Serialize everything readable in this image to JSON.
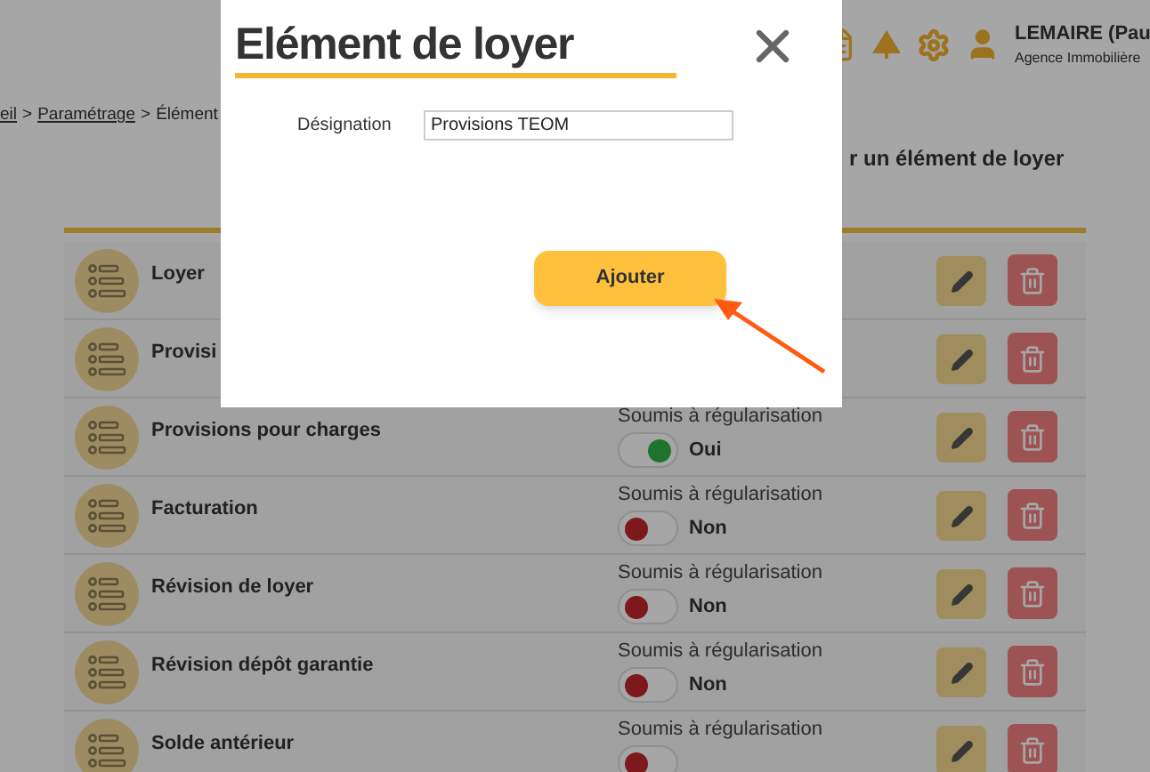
{
  "header": {
    "user_name": "LEMAIRE (Pau",
    "agency": "Agence Immobilière"
  },
  "breadcrumb": [
    {
      "label": "eil",
      "link": true
    },
    {
      "label": ">",
      "link": false
    },
    {
      "label": "Paramétrage",
      "link": true
    },
    {
      "label": ">",
      "link": false
    },
    {
      "label": "Élément",
      "link": false
    }
  ],
  "page_action": "r un élément de loyer",
  "rows": [
    {
      "name": "Loyer"
    },
    {
      "name": "Provisi"
    },
    {
      "name": "Provisions pour charges",
      "regularisation": {
        "label": "Soumis à régularisation",
        "on": true,
        "value": "Oui"
      }
    },
    {
      "name": "Facturation",
      "regularisation": {
        "label": "Soumis à régularisation",
        "on": false,
        "value": "Non"
      }
    },
    {
      "name": "Révision de loyer",
      "regularisation": {
        "label": "Soumis à régularisation",
        "on": false,
        "value": "Non"
      }
    },
    {
      "name": "Révision dépôt garantie",
      "regularisation": {
        "label": "Soumis à régularisation",
        "on": false,
        "value": "Non"
      }
    },
    {
      "name": "Solde antérieur",
      "regularisation": {
        "label": "Soumis à régularisation",
        "on": false
      }
    }
  ],
  "modal": {
    "title": "Elément de loyer",
    "field": {
      "label": "Désignation",
      "value": "Provisions TEOM"
    },
    "submit": "Ajouter"
  }
}
